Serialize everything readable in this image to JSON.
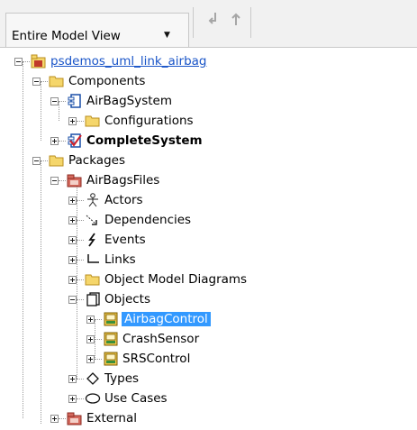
{
  "toolbar": {
    "view_select": "Entire Model View"
  },
  "tree": {
    "root": "psdemos_uml_link_airbag",
    "components": "Components",
    "airbag_system": "AirBagSystem",
    "configurations": "Configurations",
    "complete_system": "CompleteSystem",
    "packages": "Packages",
    "airbags_files": "AirBagsFiles",
    "actors": "Actors",
    "dependencies": "Dependencies",
    "events": "Events",
    "links": "Links",
    "omd": "Object Model Diagrams",
    "objects": "Objects",
    "airbag_control": "AirbagControl",
    "crash_sensor": "CrashSensor",
    "srs_control": "SRSControl",
    "types": "Types",
    "use_cases": "Use Cases",
    "external": "External"
  },
  "colors": {
    "selection": "#3399ff",
    "link": "#1a55c8",
    "folder": "#f5d66b",
    "package_red": "#c0392b"
  }
}
